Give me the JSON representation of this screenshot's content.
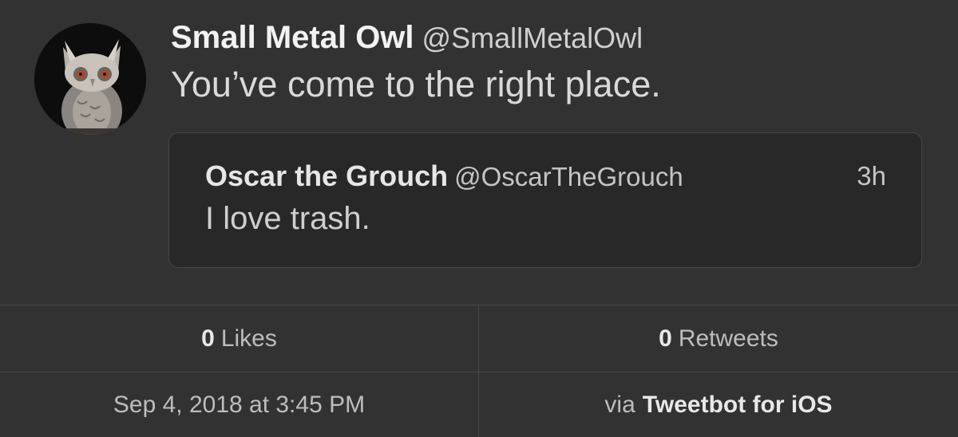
{
  "tweet": {
    "display_name": "Small Metal Owl",
    "handle": "@SmallMetalOwl",
    "text": "You’ve come to the right place."
  },
  "quote": {
    "display_name": "Oscar the Grouch",
    "handle": "@OscarTheGrouch",
    "time": "3h",
    "text": "I love trash."
  },
  "stats": {
    "likes_count": "0",
    "likes_label": "Likes",
    "retweets_count": "0",
    "retweets_label": "Retweets"
  },
  "meta": {
    "timestamp": "Sep 4, 2018 at 3:45 PM",
    "via_label": "via",
    "client": "Tweetbot for iOS"
  },
  "icons": {
    "avatar": "owl-figurine-avatar"
  }
}
